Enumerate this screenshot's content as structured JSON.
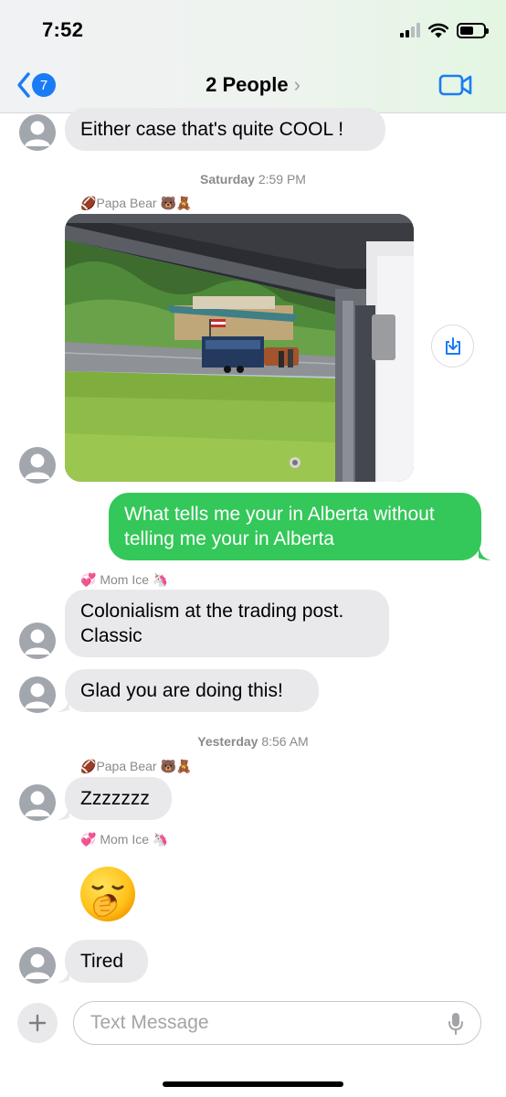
{
  "status_bar": {
    "time": "7:52"
  },
  "header": {
    "back_badge": "7",
    "title": "2 People",
    "chevron": "›"
  },
  "messages": [
    {
      "text": "Either case that's quite COOL !"
    }
  ],
  "timestamps": [
    {
      "day": "Saturday",
      "time": "2:59 PM"
    },
    {
      "day": "Yesterday",
      "time": "8:56 AM"
    }
  ],
  "senders": {
    "papa": {
      "name": "Papa Bear",
      "prefix": "🏈",
      "suffix": "🐻🧸"
    },
    "mom": {
      "name": "Mom Ice",
      "prefix": "💞",
      "suffix": "🦄"
    }
  },
  "msg_outgoing": "What tells me your in Alberta without telling me your in Alberta",
  "msg_colonialism": "Colonialism at the trading post. Classic",
  "msg_glad": "Glad you are doing this!",
  "msg_z": "Zzzzzzz",
  "msg_tired": "Tired",
  "composer": {
    "placeholder": "Text Message"
  },
  "icons": {
    "back": "chevron-left-icon",
    "video": "video-camera-icon",
    "download": "download-icon",
    "plus": "plus-icon",
    "mic": "microphone-icon",
    "avatar": "person-icon",
    "yawn": "yawning-face-emoji"
  },
  "colors": {
    "accent": "#1a7cf5",
    "outgoing": "#34c759",
    "incoming": "#e9e9eb"
  }
}
